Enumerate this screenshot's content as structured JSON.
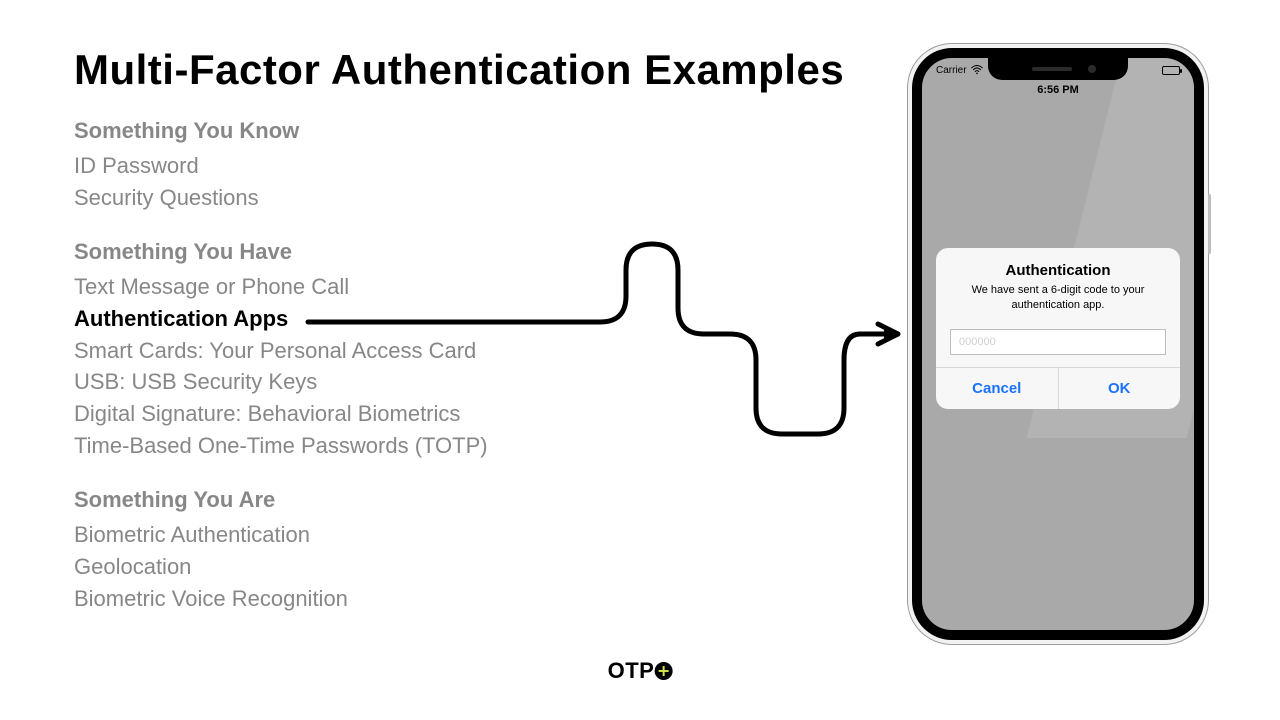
{
  "title": "Multi-Factor Authentication Examples",
  "sections": [
    {
      "title": "Something You Know",
      "items": [
        {
          "label": "ID Password",
          "highlight": false
        },
        {
          "label": "Security Questions",
          "highlight": false
        }
      ]
    },
    {
      "title": "Something You Have",
      "items": [
        {
          "label": "Text Message or Phone Call",
          "highlight": false
        },
        {
          "label": "Authentication Apps",
          "highlight": true
        },
        {
          "label": "Smart Cards: Your Personal Access Card",
          "highlight": false
        },
        {
          "label": "USB: USB Security Keys",
          "highlight": false
        },
        {
          "label": "Digital Signature: Behavioral Biometrics",
          "highlight": false
        },
        {
          "label": "Time-Based One-Time Passwords (TOTP)",
          "highlight": false
        }
      ]
    },
    {
      "title": "Something You Are",
      "items": [
        {
          "label": "Biometric Authentication",
          "highlight": false
        },
        {
          "label": "Geolocation",
          "highlight": false
        },
        {
          "label": "Biometric Voice Recognition",
          "highlight": false
        }
      ]
    }
  ],
  "footer": {
    "brand": "OTP"
  },
  "phone": {
    "carrier": "Carrier",
    "time": "6:56 PM",
    "dialog": {
      "title": "Authentication",
      "message": "We have sent a 6-digit code to your authentication app.",
      "placeholder": "000000",
      "cancel": "Cancel",
      "ok": "OK"
    }
  }
}
